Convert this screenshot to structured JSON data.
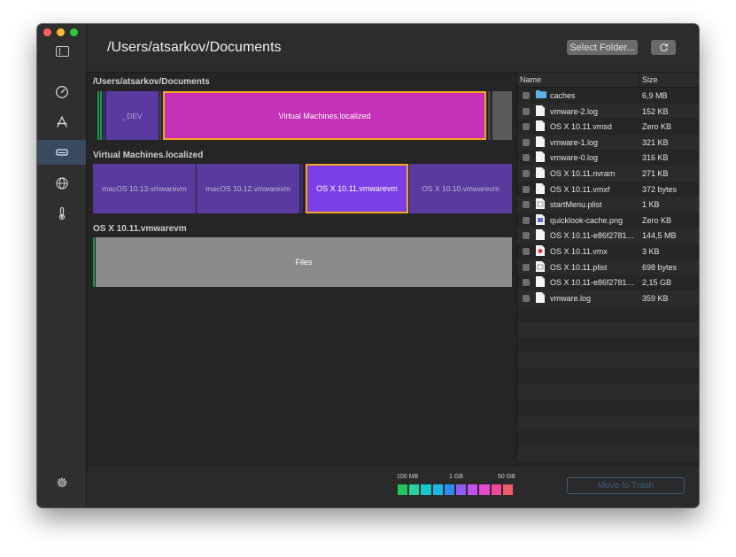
{
  "header": {
    "path": "/Users/atsarkov/Documents",
    "select_folder_label": "Select Folder..."
  },
  "sidebar": {
    "items": [
      {
        "icon": "gauge-icon"
      },
      {
        "icon": "app-store-icon"
      },
      {
        "icon": "disk-icon",
        "active": true
      },
      {
        "icon": "globe-icon"
      },
      {
        "icon": "thermometer-icon"
      }
    ],
    "settings_icon": "gear-icon"
  },
  "treemap": {
    "sections": [
      {
        "title": "/Users/atsarkov/Documents",
        "tiles": [
          {
            "label": "_DEV"
          },
          {
            "label": "Virtual Machines.localized",
            "selected": true
          }
        ]
      },
      {
        "title": "Virtual Machines.localized",
        "tiles": [
          {
            "label": "macOS 10.13.vmwarevm"
          },
          {
            "label": "macOS 10.12.vmwarevm"
          },
          {
            "label": "OS X 10.11.vmwarevm",
            "selected": true
          },
          {
            "label": "OS X 10.10.vmwarevm"
          }
        ]
      },
      {
        "title": "OS X 10.11.vmwarevm",
        "tiles": [
          {
            "label": "Files"
          }
        ]
      }
    ]
  },
  "file_list": {
    "columns": {
      "name": "Name",
      "size": "Size"
    },
    "rows": [
      {
        "name": "caches",
        "size": "6,9 MB",
        "icon": "folder-icon"
      },
      {
        "name": "vmware-2.log",
        "size": "152 KB",
        "icon": "document-icon"
      },
      {
        "name": "OS X 10.11.vmsd",
        "size": "Zero KB",
        "icon": "document-icon"
      },
      {
        "name": "vmware-1.log",
        "size": "321 KB",
        "icon": "document-icon"
      },
      {
        "name": "vmware-0.log",
        "size": "316 KB",
        "icon": "document-icon"
      },
      {
        "name": "OS X 10.11.nvram",
        "size": "271 KB",
        "icon": "document-icon"
      },
      {
        "name": "OS X 10.11.vmxf",
        "size": "372 bytes",
        "icon": "document-icon"
      },
      {
        "name": "startMenu.plist",
        "size": "1 KB",
        "icon": "plist-icon"
      },
      {
        "name": "quicklook-cache.png",
        "size": "Zero KB",
        "icon": "image-icon"
      },
      {
        "name": "OS X 10.11-e86f2781....",
        "size": "144,5 MB",
        "icon": "document-icon"
      },
      {
        "name": "OS X 10.11.vmx",
        "size": "3 KB",
        "icon": "vmx-icon"
      },
      {
        "name": "OS X 10.11.plist",
        "size": "698 bytes",
        "icon": "plist-icon"
      },
      {
        "name": "OS X 10.11-e86f2781....",
        "size": "2,15 GB",
        "icon": "document-icon"
      },
      {
        "name": "vmware.log",
        "size": "359 KB",
        "icon": "document-icon"
      }
    ]
  },
  "footer": {
    "legend": {
      "labels": [
        "100 MB",
        "1 GB",
        "50 GB"
      ],
      "colors": [
        "#22c55e",
        "#1fd4a0",
        "#18c7c7",
        "#1ab8e8",
        "#2d8cf0",
        "#8b5cf6",
        "#c04ff0",
        "#e848d0",
        "#f0479a",
        "#f25a6a"
      ]
    },
    "trash_label": "Move to Trash"
  },
  "colors": {
    "selected_border": "#f5a623",
    "selected_magenta": "#c62fb8",
    "selected_violet": "#7b3fe8",
    "purple": "#5b3aa0",
    "gray_tile": "#8a8a8a"
  }
}
